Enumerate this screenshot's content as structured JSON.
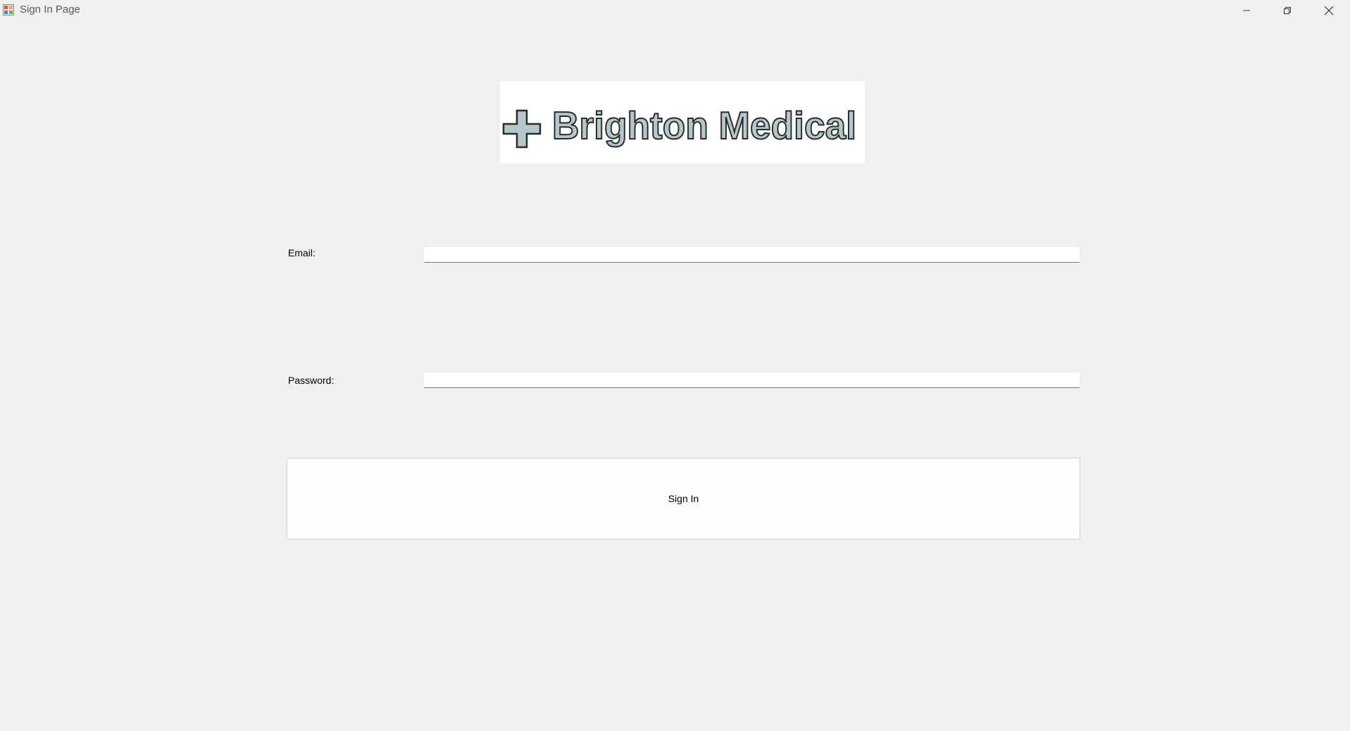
{
  "window": {
    "title": "Sign In Page",
    "app_icon": "winforms-app-icon",
    "controls": {
      "minimize_icon": "minimize-icon",
      "maximize_icon": "restore-icon",
      "close_icon": "close-icon"
    }
  },
  "logo": {
    "text": "Brighton Medical",
    "icon": "medical-cross-icon",
    "fill_color": "#b4c8cc",
    "stroke_color": "#2a2a2a"
  },
  "form": {
    "email_label": "Email:",
    "email_value": "",
    "password_label": "Password:",
    "password_value": "",
    "submit_label": "Sign In"
  }
}
